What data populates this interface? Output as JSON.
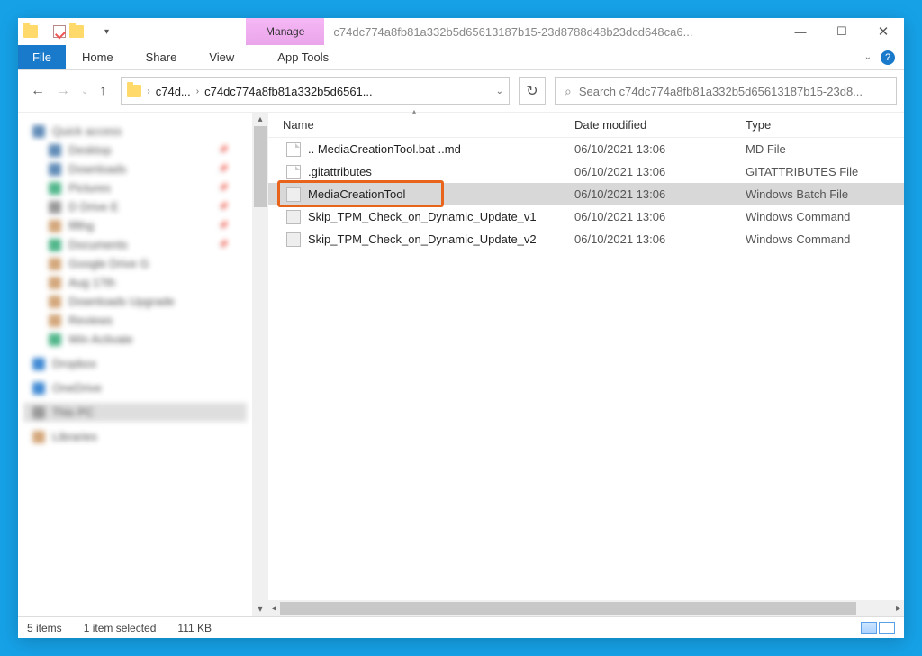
{
  "window": {
    "title": "c74dc774a8fb81a332b5d65613187b15-23d8788d48b23dcd648ca6...",
    "manage_label": "Manage"
  },
  "ribbon": {
    "file": "File",
    "home": "Home",
    "share": "Share",
    "view": "View",
    "app_tools": "App Tools"
  },
  "breadcrumbs": {
    "root": "c74d...",
    "current": "c74dc774a8fb81a332b5d6561..."
  },
  "search": {
    "placeholder": "Search c74dc774a8fb81a332b5d65613187b15-23d8..."
  },
  "columns": {
    "name": "Name",
    "date": "Date modified",
    "type": "Type"
  },
  "files": [
    {
      "name": ".. MediaCreationTool.bat ..md",
      "date": "06/10/2021 13:06",
      "type": "MD File",
      "icon": "doc",
      "selected": false
    },
    {
      "name": ".gitattributes",
      "date": "06/10/2021 13:06",
      "type": "GITATTRIBUTES File",
      "icon": "doc",
      "selected": false
    },
    {
      "name": "MediaCreationTool",
      "date": "06/10/2021 13:06",
      "type": "Windows Batch File",
      "icon": "bat",
      "selected": true
    },
    {
      "name": "Skip_TPM_Check_on_Dynamic_Update_v1",
      "date": "06/10/2021 13:06",
      "type": "Windows Command",
      "icon": "cmd",
      "selected": false
    },
    {
      "name": "Skip_TPM_Check_on_Dynamic_Update_v2",
      "date": "06/10/2021 13:06",
      "type": "Windows Command",
      "icon": "cmd",
      "selected": false
    }
  ],
  "sidebar": {
    "items": [
      {
        "label": "Quick access",
        "color": "#47a",
        "indent": 0,
        "pin": false
      },
      {
        "label": "Desktop",
        "color": "#47a",
        "indent": 1,
        "pin": true
      },
      {
        "label": "Downloads",
        "color": "#47a",
        "indent": 1,
        "pin": true
      },
      {
        "label": "Pictures",
        "color": "#3a7",
        "indent": 1,
        "pin": true
      },
      {
        "label": "D Drive E",
        "color": "#888",
        "indent": 1,
        "pin": true
      },
      {
        "label": "fifthg",
        "color": "#c96",
        "indent": 1,
        "pin": true
      },
      {
        "label": "Documents",
        "color": "#3a7",
        "indent": 1,
        "pin": true
      },
      {
        "label": "Google Drive G",
        "color": "#c96",
        "indent": 1,
        "pin": false
      },
      {
        "label": "Aug 17th",
        "color": "#c96",
        "indent": 1,
        "pin": false
      },
      {
        "label": "Downloads Upgrade",
        "color": "#c96",
        "indent": 1,
        "pin": false
      },
      {
        "label": "Reviews",
        "color": "#c96",
        "indent": 1,
        "pin": false
      },
      {
        "label": "Win Activate",
        "color": "#3a7",
        "indent": 1,
        "pin": false
      },
      {
        "label": "",
        "color": "transparent",
        "indent": 0,
        "pin": false
      },
      {
        "label": "Dropbox",
        "color": "#27c",
        "indent": 0,
        "pin": false
      },
      {
        "label": "",
        "color": "transparent",
        "indent": 0,
        "pin": false
      },
      {
        "label": "OneDrive",
        "color": "#27c",
        "indent": 0,
        "pin": false
      },
      {
        "label": "",
        "color": "transparent",
        "indent": 0,
        "pin": false
      },
      {
        "label": "This PC",
        "color": "#888",
        "indent": 0,
        "pin": false,
        "selected": true
      },
      {
        "label": "",
        "color": "transparent",
        "indent": 0,
        "pin": false
      },
      {
        "label": "Libraries",
        "color": "#c96",
        "indent": 0,
        "pin": false
      }
    ]
  },
  "status": {
    "count": "5 items",
    "selection": "1 item selected",
    "size": "111 KB"
  }
}
